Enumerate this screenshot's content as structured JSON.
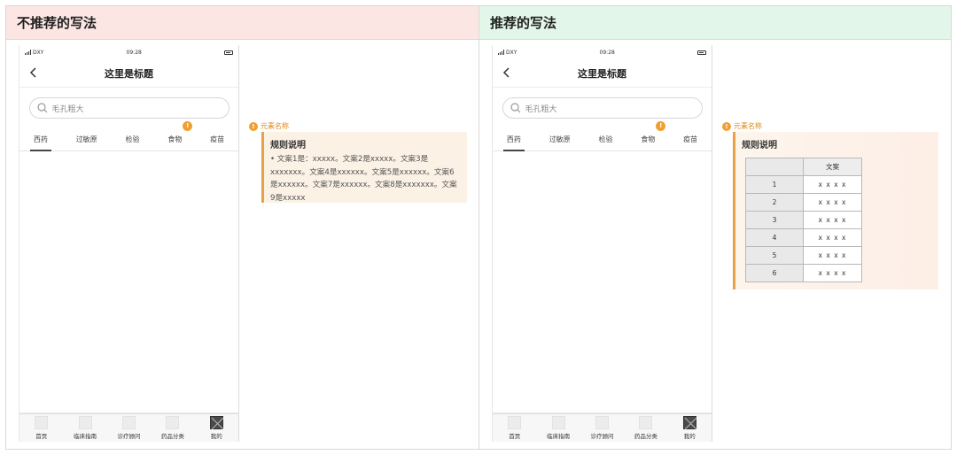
{
  "panels": {
    "left": {
      "title": "不推荐的写法",
      "annotation": {
        "label": "元素名称",
        "badge": "!",
        "card_title": "规则说明",
        "card_text": "• 文案1是：xxxxx。文案2是xxxxx。文案3是xxxxxxx。文案4是xxxxxx。文案5是xxxxxx。文案6是xxxxxx。文案7是xxxxxx。文案8是xxxxxxx。文案9是xxxxx"
      }
    },
    "right": {
      "title": "推荐的写法",
      "annotation": {
        "label": "元素名称",
        "badge": "!",
        "card_title": "规则说明",
        "table_header": "文案",
        "table_rows": [
          {
            "index": "1",
            "value": "x x x x"
          },
          {
            "index": "2",
            "value": "x x x x"
          },
          {
            "index": "3",
            "value": "x x x x"
          },
          {
            "index": "4",
            "value": "x x x x"
          },
          {
            "index": "5",
            "value": "x x x x"
          },
          {
            "index": "6",
            "value": "x x x x"
          }
        ]
      }
    }
  },
  "phone": {
    "carrier": "DXY",
    "time": "09:28",
    "nav_title": "这里是标题",
    "search_placeholder": "毛孔粗大",
    "tabs": [
      "西药",
      "过敏原",
      "检验",
      "食物",
      "疫苗"
    ],
    "tab_badge": "!",
    "tabbar": [
      "首页",
      "临床指南",
      "诊疗顾问",
      "药品分类",
      "我的"
    ]
  }
}
